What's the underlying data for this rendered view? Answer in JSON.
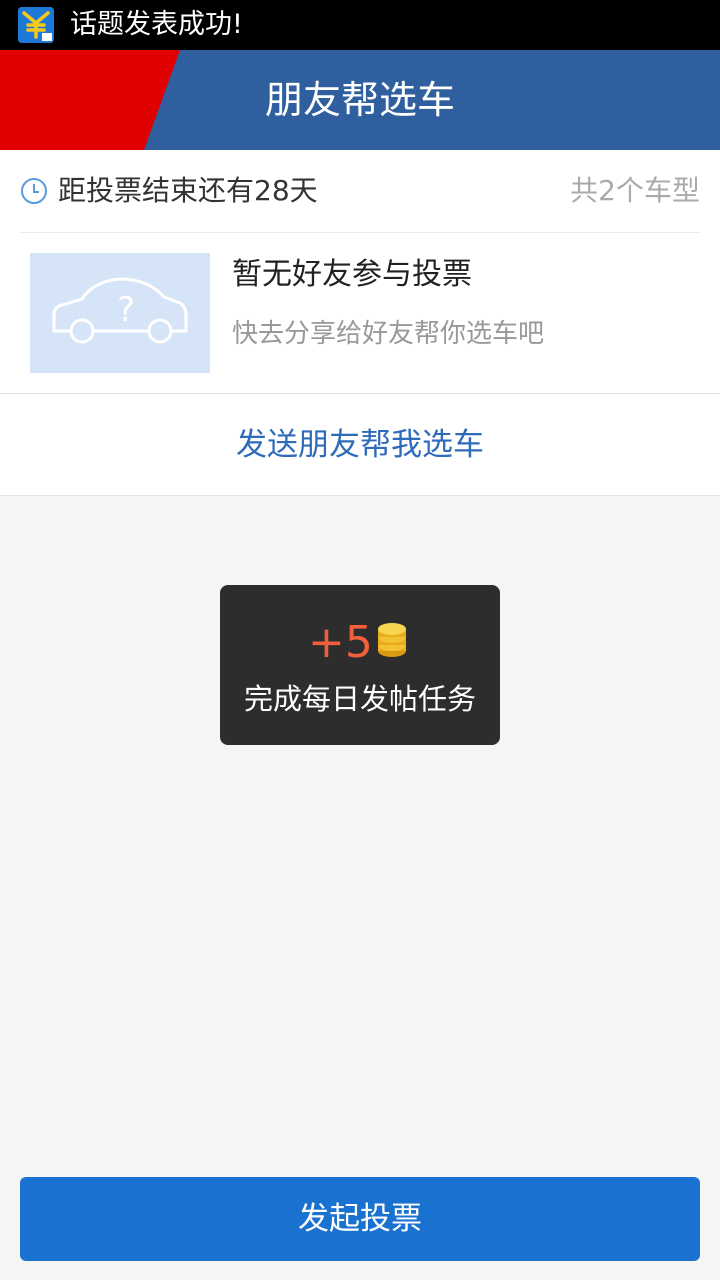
{
  "status_bar": {
    "notification_text": "话题发表成功!",
    "app_icon": "yuan-coin-app-icon"
  },
  "header": {
    "title": "朋友帮选车",
    "brand_colors": {
      "red": "#e10000",
      "blue": "#2f5f9e"
    }
  },
  "vote_card": {
    "countdown_text": "距投票结束还有28天",
    "model_count_text": "共2个车型",
    "empty_title": "暂无好友参与投票",
    "empty_hint": "快去分享给好友帮你选车吧",
    "thumb_icon": "unknown-car-icon"
  },
  "send_row": {
    "label": "发送朋友帮我选车"
  },
  "toast": {
    "points": "+5",
    "message": "完成每日发帖任务",
    "icon": "coin-stack-icon"
  },
  "bottom_button": {
    "label": "发起投票",
    "color": "#1972d0"
  }
}
